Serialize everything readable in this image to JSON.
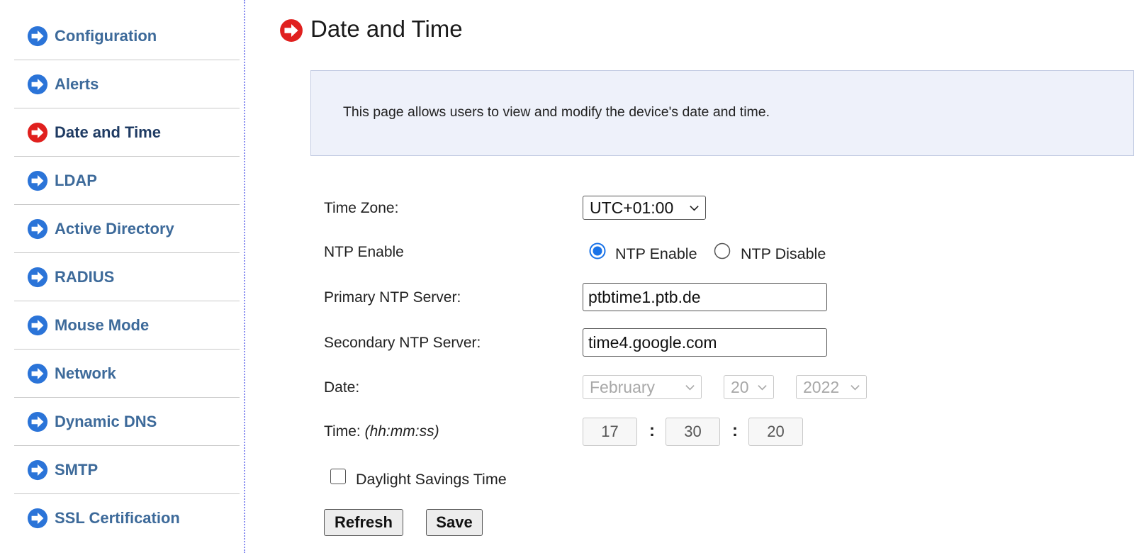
{
  "sidebar": {
    "items": [
      {
        "label": "Configuration",
        "active": false
      },
      {
        "label": "Alerts",
        "active": false
      },
      {
        "label": "Date and Time",
        "active": true
      },
      {
        "label": "LDAP",
        "active": false
      },
      {
        "label": "Active Directory",
        "active": false
      },
      {
        "label": "RADIUS",
        "active": false
      },
      {
        "label": "Mouse Mode",
        "active": false
      },
      {
        "label": "Network",
        "active": false
      },
      {
        "label": "Dynamic DNS",
        "active": false
      },
      {
        "label": "SMTP",
        "active": false
      },
      {
        "label": "SSL Certification",
        "active": false
      }
    ]
  },
  "colors": {
    "nav_icon": "#2b74d8",
    "active_icon": "#e0201e",
    "nav_text": "#3d6a9a",
    "active_text": "#1f3b63",
    "info_bg": "#eef1fa",
    "radio_selected": "#1a73e8"
  },
  "icons": {
    "nav": "arrow-right-circle-icon",
    "active": "arrow-right-circle-icon",
    "title": "arrow-right-circle-icon",
    "dropdown": "chevron-down-icon"
  },
  "page": {
    "title": "Date and Time",
    "description": "This page allows users to view and modify the device's date and time."
  },
  "form": {
    "timezone": {
      "label": "Time Zone:",
      "value": "UTC+01:00"
    },
    "ntp": {
      "label": "NTP Enable",
      "enable_label": "NTP Enable",
      "disable_label": "NTP Disable",
      "selected": "enable"
    },
    "primary_ntp": {
      "label": "Primary NTP Server:",
      "value": "ptbtime1.ptb.de"
    },
    "secondary_ntp": {
      "label": "Secondary NTP Server:",
      "value": "time4.google.com"
    },
    "date": {
      "label": "Date:",
      "month": "February",
      "day": "20",
      "year": "2022"
    },
    "time": {
      "label": "Time:",
      "format": "(hh:mm:ss)",
      "hh": "17",
      "mm": "30",
      "ss": "20",
      "separator": ":"
    },
    "dst": {
      "label": "Daylight Savings Time",
      "checked": false
    }
  },
  "buttons": {
    "refresh": "Refresh",
    "save": "Save"
  }
}
